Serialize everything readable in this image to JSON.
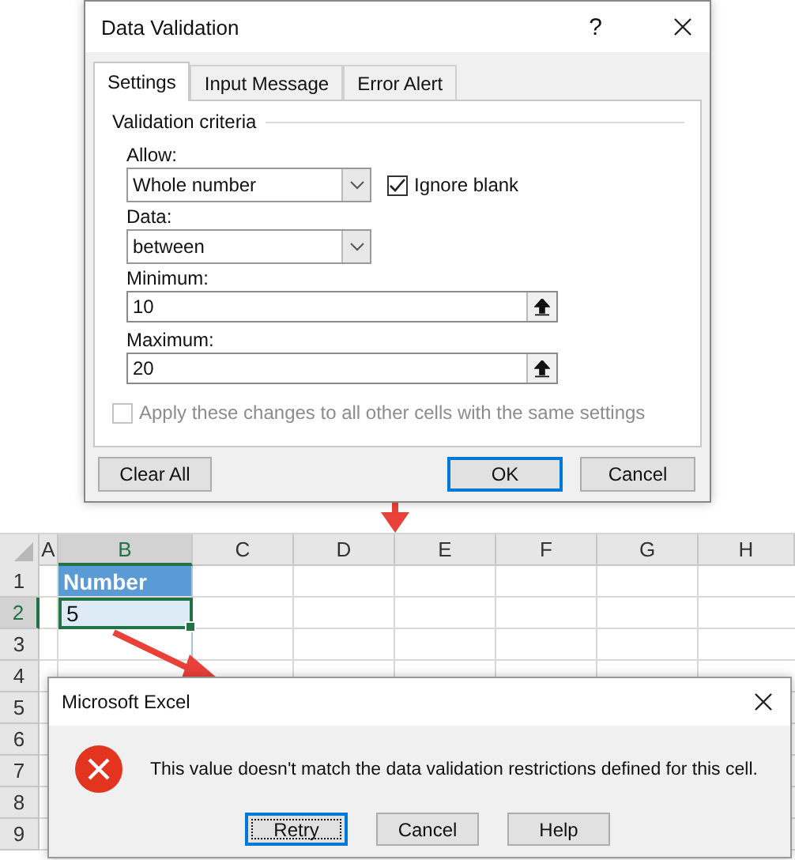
{
  "data_validation": {
    "title": "Data Validation",
    "help": "?",
    "tabs": [
      {
        "label": "Settings",
        "selected": true
      },
      {
        "label": "Input Message",
        "selected": false
      },
      {
        "label": "Error Alert",
        "selected": false
      }
    ],
    "section_title": "Validation criteria",
    "allow": {
      "label": "Allow:",
      "value": "Whole number"
    },
    "ignore_blank": {
      "label": "Ignore blank",
      "checked": true
    },
    "data": {
      "label": "Data:",
      "value": "between"
    },
    "minimum": {
      "label": "Minimum:",
      "value": "10"
    },
    "maximum": {
      "label": "Maximum:",
      "value": "20"
    },
    "apply_all": {
      "label": "Apply these changes to all other cells with the same settings",
      "checked": false,
      "disabled": true
    },
    "buttons": [
      {
        "label": "Clear All",
        "default": false
      },
      {
        "label": "OK",
        "default": true
      },
      {
        "label": "Cancel",
        "default": false
      }
    ]
  },
  "spreadsheet": {
    "columns": [
      {
        "label": "A",
        "selected": false
      },
      {
        "label": "B",
        "selected": true
      },
      {
        "label": "C",
        "selected": false
      },
      {
        "label": "D",
        "selected": false
      },
      {
        "label": "E",
        "selected": false
      },
      {
        "label": "F",
        "selected": false
      },
      {
        "label": "G",
        "selected": false
      },
      {
        "label": "H",
        "selected": false
      }
    ],
    "rows": [
      {
        "header": "1",
        "selected": false,
        "cell_b": {
          "text": "Number",
          "kind": "heading",
          "selected": false
        }
      },
      {
        "header": "2",
        "selected": true,
        "cell_b": {
          "text": "5",
          "kind": "value",
          "selected": true
        }
      },
      {
        "header": "3",
        "selected": false
      },
      {
        "header": "4",
        "selected": false
      },
      {
        "header": "5",
        "selected": false
      },
      {
        "header": "6",
        "selected": false
      },
      {
        "header": "7",
        "selected": false
      },
      {
        "header": "8",
        "selected": false
      },
      {
        "header": "9",
        "selected": false
      }
    ]
  },
  "error_dialog": {
    "title": "Microsoft Excel",
    "message": "This value doesn't match the data validation restrictions defined for this cell.",
    "buttons": [
      {
        "label": "Retry",
        "default": true
      },
      {
        "label": "Cancel",
        "default": false
      },
      {
        "label": "Help",
        "default": false
      }
    ]
  }
}
